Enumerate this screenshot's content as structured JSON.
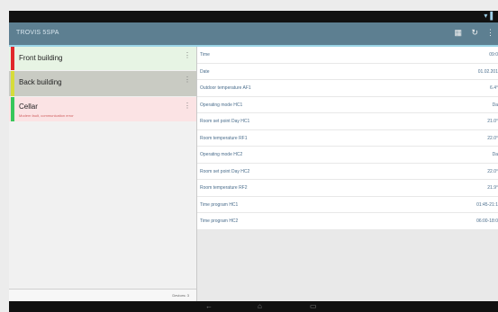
{
  "app": {
    "title": "TROVIS 5SPA"
  },
  "status": {
    "indicator": "▾▐"
  },
  "appbar_icons": {
    "grid": "▦",
    "refresh": "↻",
    "menu": "⋮"
  },
  "sidebar": {
    "items": [
      {
        "name": "Front building",
        "color": "#e0292b",
        "bg": "#e7f4e4",
        "subtitle": ""
      },
      {
        "name": "Back building",
        "color": "#d6dc3a",
        "bg": "#c9cbc3",
        "subtitle": ""
      },
      {
        "name": "Cellar",
        "color": "#38c65a",
        "bg": "#fbe3e4",
        "subtitle": "Modem fault, communication error"
      }
    ],
    "footer": "Devices: 3"
  },
  "details": {
    "rows": [
      {
        "key": "Time",
        "value": "09:0"
      },
      {
        "key": "Date",
        "value": "01.02.201"
      },
      {
        "key": "Outdoor temperature AF1",
        "value": "6.4°"
      },
      {
        "key": "Operating mode HC1",
        "value": "Da"
      },
      {
        "key": "Room set point Day HC1",
        "value": "21.0°"
      },
      {
        "key": "Room temperature RF1",
        "value": "22.0°"
      },
      {
        "key": "Operating mode HC2",
        "value": "Da"
      },
      {
        "key": "Room set point Day HC2",
        "value": "22.0°"
      },
      {
        "key": "Room temperature RF2",
        "value": "21.9°"
      },
      {
        "key": "Time program HC1",
        "value": "01:45-21:1"
      },
      {
        "key": "Time program HC2",
        "value": "06:00-18:0"
      }
    ]
  },
  "navbar": {
    "back": "←",
    "home": "⌂",
    "recent": "▭"
  }
}
